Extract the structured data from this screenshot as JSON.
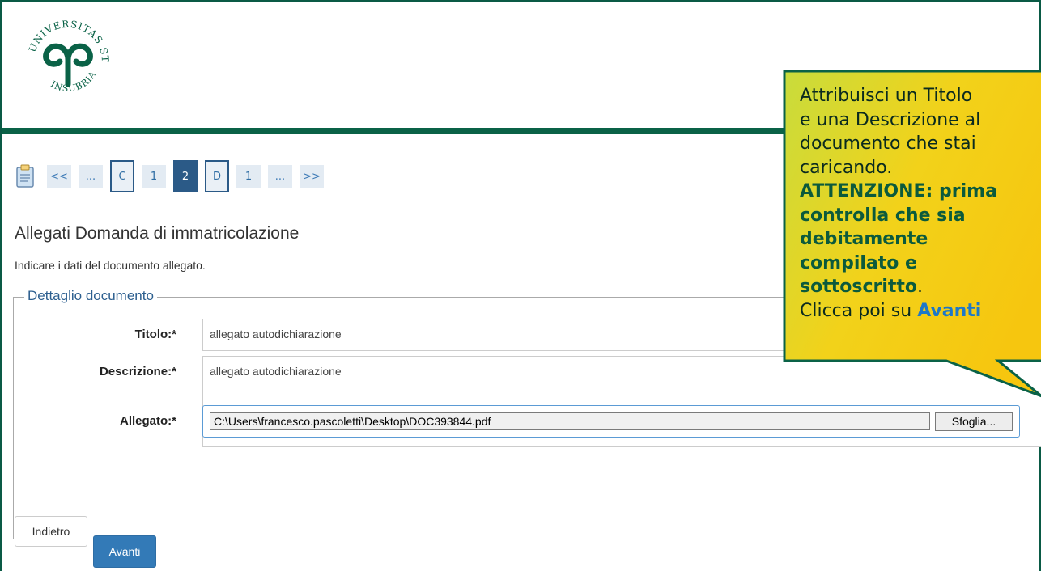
{
  "header": {
    "logo_alt": "UNIVERSITAS STUDIORUM INSUBRIAE",
    "logo_text_top": "STUDIORUM",
    "logo_text_left": "UNIVERSITAS",
    "logo_text_right": "INSUBRIAE"
  },
  "steps": [
    {
      "label": "<<",
      "type": "nav"
    },
    {
      "label": "...",
      "type": "nav"
    },
    {
      "label": "C",
      "type": "boxed"
    },
    {
      "label": "1",
      "type": "plain"
    },
    {
      "label": "2",
      "type": "active"
    },
    {
      "label": "D",
      "type": "boxed"
    },
    {
      "label": "1",
      "type": "plain"
    },
    {
      "label": "...",
      "type": "nav"
    },
    {
      "label": ">>",
      "type": "nav"
    }
  ],
  "page": {
    "title": "Allegati Domanda di immatricolazione",
    "subtitle": "Indicare i dati del documento allegato."
  },
  "form": {
    "legend": "Dettaglio documento",
    "titolo_label": "Titolo:*",
    "titolo_value": "allegato autodichiarazione",
    "descrizione_label": "Descrizione:*",
    "descrizione_value": "allegato autodichiarazione",
    "allegato_label": "Allegato:*",
    "allegato_path": "C:\\Users\\francesco.pascoletti\\Desktop\\DOC393844.pdf",
    "browse_label": "Sfoglia..."
  },
  "buttons": {
    "back": "Indietro",
    "next": "Avanti"
  },
  "callout": {
    "line1": "Attribuisci un Titolo",
    "line2": "e una Descrizione al",
    "line3": "documento che stai",
    "line4": "caricando.",
    "warn1": "ATTENZIONE: prima",
    "warn2": "controlla che sia",
    "warn3": "debitamente",
    "warn4": "compilato e",
    "warn5": "sottoscritto",
    "warn_end": ".",
    "click_prefix": "Clicca poi su ",
    "click_target": "Avanti"
  },
  "colors": {
    "brand_green": "#0a6247",
    "step_active": "#2b5a87",
    "primary_button": "#337ab7",
    "callout_fill": "#f2d21a",
    "callout_fill_light": "#c8dc3c"
  }
}
